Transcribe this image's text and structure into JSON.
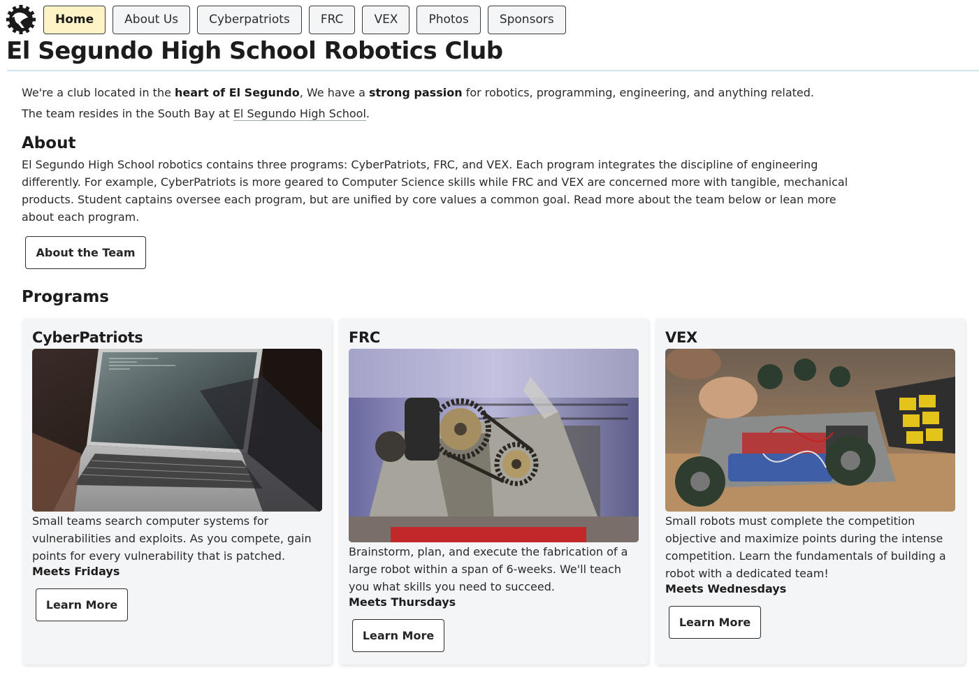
{
  "nav": {
    "items": [
      {
        "label": "Home",
        "active": true
      },
      {
        "label": "About Us",
        "active": false
      },
      {
        "label": "Cyberpatriots",
        "active": false
      },
      {
        "label": "FRC",
        "active": false
      },
      {
        "label": "VEX",
        "active": false
      },
      {
        "label": "Photos",
        "active": false
      },
      {
        "label": "Sponsors",
        "active": false
      }
    ],
    "logo_icon": "eagle-gear-logo"
  },
  "site_title": "El Segundo High School Robotics Club",
  "intro": {
    "line1_a": "We're a club located in the ",
    "line1_b": "heart of El Segundo",
    "line1_c": ", We have a ",
    "line1_d": "strong passion",
    "line1_e": " for robotics, programming, engineering, and anything related.",
    "line2_a": "The team resides in the South Bay at ",
    "line2_b": "El Segundo High School",
    "line2_c": "."
  },
  "about": {
    "heading": "About",
    "text": "El Segundo High School robotics contains three programs: CyberPatriots, FRC, and VEX. Each program integrates the discipline of engineering differently. For example, CyberPatriots is more geared to Computer Science skills while FRC and VEX are concerned more with tangible, mechanical products. Student captains oversee each program, but are unified by core values a common goal. Read more about the team below or lean more about each program.",
    "button": "About the Team"
  },
  "programs": {
    "heading": "Programs",
    "cards": [
      {
        "title": "CyberPatriots",
        "image_icon": "laptop-terminal-photo",
        "description": "Small teams search computer systems for vulnerabilities and exploits. As you compete, gain points for every vulnerability that is patched.",
        "meets": "Meets Fridays",
        "button": "Learn More"
      },
      {
        "title": "FRC",
        "image_icon": "robot-gearbox-photo",
        "description": "Brainstorm, plan, and execute the fabrication of a large robot within a span of 6-weeks. We'll teach you what skills you need to succeed.",
        "meets": "Meets Thursdays",
        "button": "Learn More"
      },
      {
        "title": "VEX",
        "image_icon": "vex-robot-build-photo",
        "description": "Small robots must complete the competition objective and maximize points during the intense competition. Learn the fundamentals of building a robot with a dedicated team!",
        "meets": "Meets Wednesdays",
        "button": "Learn More"
      }
    ]
  },
  "colors": {
    "active_nav": "#fdf3c7",
    "card_bg": "#f4f5f7",
    "title_rule": "#cfe7ec"
  }
}
